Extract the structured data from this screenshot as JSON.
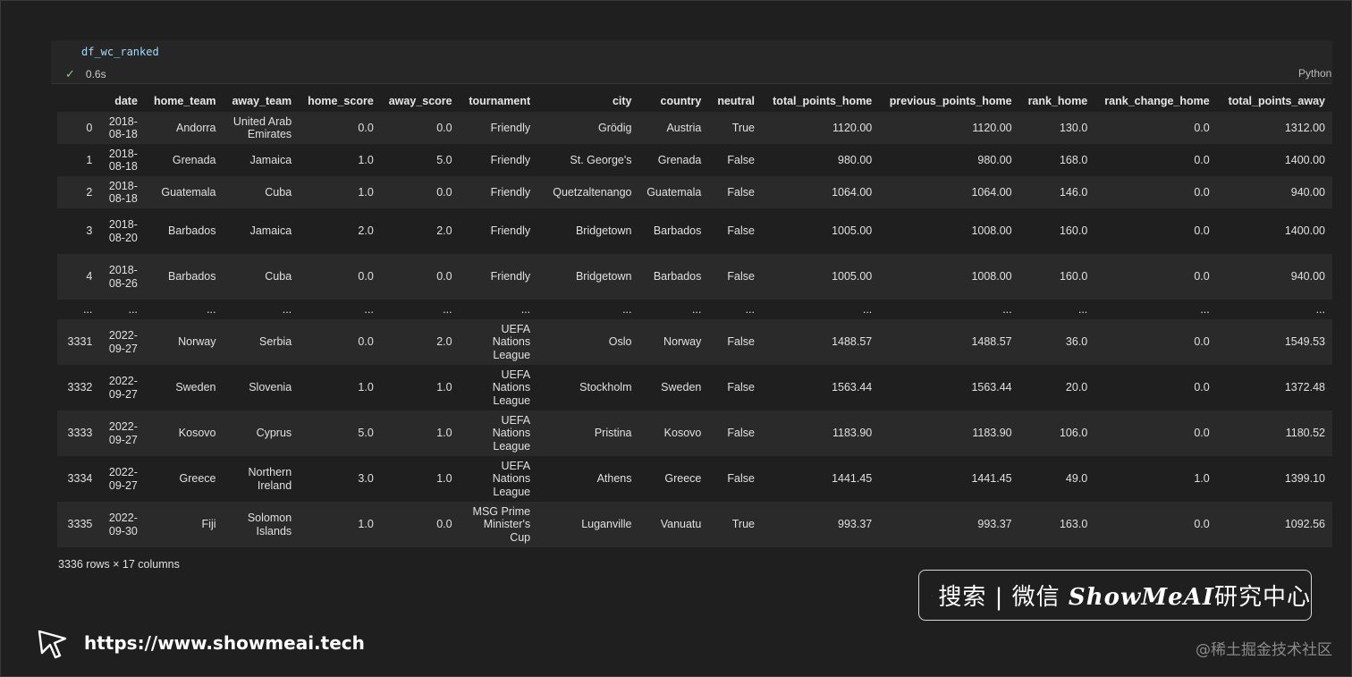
{
  "cell": {
    "code": "df_wc_ranked",
    "status_time": "0.6s",
    "language": "Python"
  },
  "table": {
    "columns": [
      "",
      "date",
      "home_team",
      "away_team",
      "home_score",
      "away_score",
      "tournament",
      "city",
      "country",
      "neutral",
      "total_points_home",
      "previous_points_home",
      "rank_home",
      "rank_change_home",
      "total_points_away"
    ],
    "rows": [
      [
        "0",
        "2018-08-18",
        "Andorra",
        "United Arab Emirates",
        "0.0",
        "0.0",
        "Friendly",
        "Grödig",
        "Austria",
        "True",
        "1120.00",
        "1120.00",
        "130.0",
        "0.0",
        "1312.00"
      ],
      [
        "1",
        "2018-08-18",
        "Grenada",
        "Jamaica",
        "1.0",
        "5.0",
        "Friendly",
        "St. George's",
        "Grenada",
        "False",
        "980.00",
        "980.00",
        "168.0",
        "0.0",
        "1400.00"
      ],
      [
        "2",
        "2018-08-18",
        "Guatemala",
        "Cuba",
        "1.0",
        "0.0",
        "Friendly",
        "Quetzaltenango",
        "Guatemala",
        "False",
        "1064.00",
        "1064.00",
        "146.0",
        "0.0",
        "940.00"
      ],
      [
        "3",
        "2018-08-20",
        "Barbados",
        "Jamaica",
        "2.0",
        "2.0",
        "Friendly",
        "Bridgetown",
        "Barbados",
        "False",
        "1005.00",
        "1008.00",
        "160.0",
        "0.0",
        "1400.00"
      ],
      [
        "4",
        "2018-08-26",
        "Barbados",
        "Cuba",
        "0.0",
        "0.0",
        "Friendly",
        "Bridgetown",
        "Barbados",
        "False",
        "1005.00",
        "1008.00",
        "160.0",
        "0.0",
        "940.00"
      ],
      [
        "...",
        "...",
        "...",
        "...",
        "...",
        "...",
        "...",
        "...",
        "...",
        "...",
        "...",
        "...",
        "...",
        "...",
        "..."
      ],
      [
        "3331",
        "2022-09-27",
        "Norway",
        "Serbia",
        "0.0",
        "2.0",
        "UEFA Nations League",
        "Oslo",
        "Norway",
        "False",
        "1488.57",
        "1488.57",
        "36.0",
        "0.0",
        "1549.53"
      ],
      [
        "3332",
        "2022-09-27",
        "Sweden",
        "Slovenia",
        "1.0",
        "1.0",
        "UEFA Nations League",
        "Stockholm",
        "Sweden",
        "False",
        "1563.44",
        "1563.44",
        "20.0",
        "0.0",
        "1372.48"
      ],
      [
        "3333",
        "2022-09-27",
        "Kosovo",
        "Cyprus",
        "5.0",
        "1.0",
        "UEFA Nations League",
        "Pristina",
        "Kosovo",
        "False",
        "1183.90",
        "1183.90",
        "106.0",
        "0.0",
        "1180.52"
      ],
      [
        "3334",
        "2022-09-27",
        "Greece",
        "Northern Ireland",
        "3.0",
        "1.0",
        "UEFA Nations League",
        "Athens",
        "Greece",
        "False",
        "1441.45",
        "1441.45",
        "49.0",
        "1.0",
        "1399.10"
      ],
      [
        "3335",
        "2022-09-30",
        "Fiji",
        "Solomon Islands",
        "1.0",
        "0.0",
        "MSG Prime Minister's Cup",
        "Luganville",
        "Vanuatu",
        "True",
        "993.37",
        "993.37",
        "163.0",
        "0.0",
        "1092.56"
      ]
    ],
    "shape": "3336 rows × 17 columns"
  },
  "watermark": {
    "search_text": "搜索 | 微信",
    "brand": "ShowMeAI",
    "suffix": "研究中心",
    "url": "https://www.showmeai.tech",
    "juejin": "@稀土掘金技术社区"
  },
  "icons": [
    "check-icon",
    "search-icon",
    "cursor-arrow-icon"
  ]
}
